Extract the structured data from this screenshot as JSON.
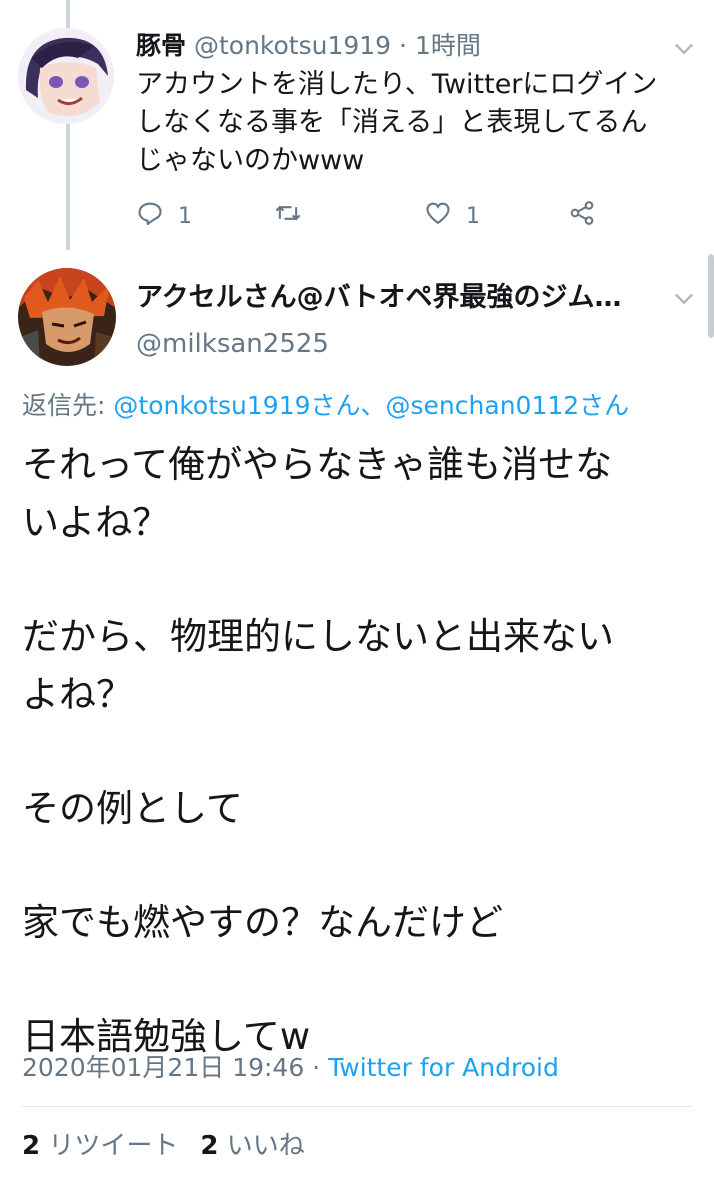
{
  "tweet1": {
    "name": "豚骨",
    "handle": "@tonkotsu1919",
    "time": "1時間",
    "body": "アカウントを消したり、Twitterにログイン\nしなくなる事を「消える」と表現してるん\nじゃないのかwww",
    "reply_count": "1",
    "like_count": "1",
    "icons": [
      "reply-icon",
      "retweet-icon",
      "like-icon",
      "share-icon"
    ]
  },
  "tweet2": {
    "name": "アクセルさん@バトオペ界最強のジム…",
    "handle": "@milksan2525",
    "replying_prefix": "返信先:",
    "replying_1": "@tonkotsu1919さん",
    "replying_sep": "、",
    "replying_2": "@senchan0112さん",
    "paragraphs": [
      "それって俺がやらなきゃ誰も消せな\nいよね？",
      "だから、物理的にしないと出来ない\nよね？",
      "その例として",
      "家でも燃やすの？なんだけど",
      "日本語勉強してw"
    ],
    "timestamp": "2020年01月21日 19:46",
    "source": "Twitter for Android",
    "retweets_num": "2",
    "retweets_label": "リツイート",
    "likes_num": "2",
    "likes_label": "いいね"
  },
  "colors": {
    "link": "#1da1f2",
    "muted": "#657786",
    "text": "#14171a",
    "divider": "#e1e8ed"
  }
}
